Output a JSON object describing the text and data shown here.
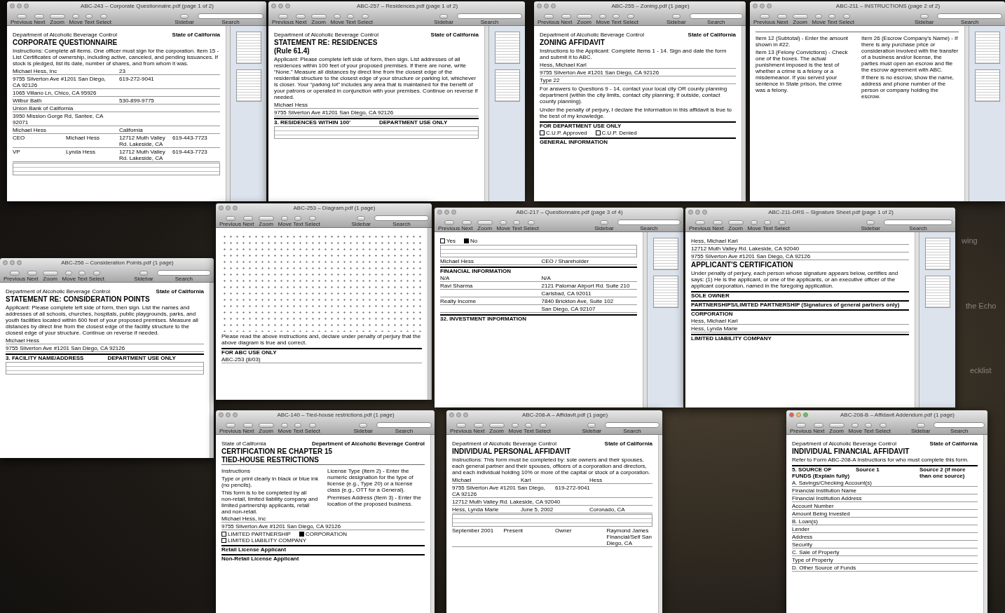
{
  "desktop_labels": [
    "wing",
    "the Echo",
    "ecklist"
  ],
  "windows": [
    {
      "title": "ABC-243 – Corporate Questionnaire.pdf (page 1 of 2)",
      "active": false,
      "sidebar": true,
      "toolbar": {
        "nav": [
          "Previous",
          "Next"
        ],
        "zoom": "Zoom",
        "tools": [
          "Move",
          "Text",
          "Select"
        ],
        "sidebar": "Sidebar",
        "search": "Search"
      },
      "page": [
        {
          "kind": "agency",
          "left": "Department of Alcoholic Beverage Control",
          "right": "State of California"
        },
        {
          "kind": "heading",
          "text": "CORPORATE QUESTIONNAIRE"
        },
        {
          "kind": "para",
          "text": "Instructions: Complete all items. One officer must sign for the corporation. Item 15 - List Certificates of ownership, including active, canceled, and pending issuances. If stock is pledged, list its date, number of shares, and from whom it was."
        },
        {
          "kind": "row",
          "cells": [
            "Michael Hess, Inc",
            "23"
          ]
        },
        {
          "kind": "row",
          "cells": [
            "9755 Silverton Ave #1201 San Diego, CA 92126",
            "619-272-9041"
          ]
        },
        {
          "kind": "row",
          "cells": [
            "1065 Villano Ln, Chico, CA 95926",
            ""
          ]
        },
        {
          "kind": "row",
          "cells": [
            "Wilbur Bath",
            "530-899-9775"
          ]
        },
        {
          "kind": "row",
          "cells": [
            "Union Bank of California",
            ""
          ]
        },
        {
          "kind": "row",
          "cells": [
            "3950 Mission Gorge Rd, Santee, CA 92071",
            ""
          ]
        },
        {
          "kind": "row",
          "cells": [
            "Michael Hess",
            "California"
          ]
        },
        {
          "kind": "row",
          "cells": [
            "CEO",
            "Michael Hess",
            "12712 Muth Valley Rd. Lakeside, CA",
            "619-443-7723"
          ]
        },
        {
          "kind": "row",
          "cells": [
            "VP",
            "Lynda Hess",
            "12712 Muth Valley Rd. Lakeside, CA",
            "619-443-7723"
          ]
        },
        {
          "kind": "grid"
        }
      ]
    },
    {
      "title": "ABC-257 – Residences.pdf (page 1 of 2)",
      "active": false,
      "sidebar": true,
      "toolbar": {
        "nav": [
          "Previous",
          "Next"
        ],
        "zoom": "Zoom",
        "tools": [
          "Move",
          "Text",
          "Select"
        ],
        "sidebar": "Sidebar",
        "search": "Search"
      },
      "page": [
        {
          "kind": "agency",
          "left": "Department of Alcoholic Beverage Control",
          "right": "State of California"
        },
        {
          "kind": "heading",
          "text": "STATEMENT RE: RESIDENCES"
        },
        {
          "kind": "heading",
          "text": "(Rule 61.4)"
        },
        {
          "kind": "para",
          "text": "Applicant: Please complete left side of form, then sign. List addresses of all residences within 100 feet of your proposed premises. If there are none, write “None.” Measure all distances by direct line from the closest edge of the residential structure to the closest edge of your structure or parking lot, whichever is closer. Your “parking lot” includes any area that is maintained for the benefit of your patrons or operated in conjunction with your premises. Continue on reverse if needed."
        },
        {
          "kind": "row",
          "cells": [
            "Michael Hess"
          ]
        },
        {
          "kind": "row",
          "cells": [
            "9755 Silverton Ave #1201 San Diego, CA 92126"
          ]
        },
        {
          "kind": "section",
          "cells": [
            "3. RESIDENCES WITHIN 100'",
            "DEPARTMENT USE ONLY"
          ]
        },
        {
          "kind": "grid"
        }
      ]
    },
    {
      "title": "ABC-255 – Zoning.pdf (1 page)",
      "active": false,
      "sidebar": false,
      "toolbar": {
        "nav": [
          "Previous",
          "Next"
        ],
        "zoom": "Zoom",
        "tools": [
          "Move",
          "Text",
          "Select"
        ],
        "sidebar": "Sidebar",
        "search": "Search"
      },
      "page": [
        {
          "kind": "agency",
          "left": "Department of Alcoholic Beverage Control",
          "right": "State of California"
        },
        {
          "kind": "heading",
          "text": "ZONING AFFIDAVIT"
        },
        {
          "kind": "para",
          "text": "Instructions to the Applicant: Complete Items 1 - 14. Sign and date the form and submit it to ABC."
        },
        {
          "kind": "row",
          "cells": [
            "Hess, Michael Karl"
          ]
        },
        {
          "kind": "row",
          "cells": [
            "9755 Silverton Ave #1201 San Diego, CA 92126"
          ]
        },
        {
          "kind": "row",
          "cells": [
            "Type 22"
          ]
        },
        {
          "kind": "para",
          "text": "For answers to Questions 9 - 14, contact your local city OR county planning department (within the city limits, contact city planning; if outside, contact county planning)."
        },
        {
          "kind": "para",
          "text": "Under the penalty of perjury, I declare the information in this affidavit is true to the best of my knowledge."
        },
        {
          "kind": "section",
          "cells": [
            "FOR DEPARTMENT USE ONLY"
          ]
        },
        {
          "kind": "checks",
          "items": [
            {
              "text": "C.U.P. Approved",
              "checked": false
            },
            {
              "text": "C.U.P. Denied",
              "checked": false
            }
          ]
        },
        {
          "kind": "section",
          "cells": [
            "GENERAL INFORMATION"
          ]
        }
      ]
    },
    {
      "title": "ABC-211 – INSTRUCTIONS (page 2 of 2)",
      "active": false,
      "sidebar": true,
      "toolbar": {
        "nav": [
          "Previous",
          "Next"
        ],
        "zoom": "Zoom",
        "tools": [
          "Move",
          "Text",
          "Select"
        ],
        "sidebar": "Sidebar",
        "search": "Search"
      },
      "page": [
        {
          "kind": "columns",
          "left": [
            "Item 12 (Subtotal) - Enter the amount shown in #22.",
            "Item 13 (Felony Convictions) - Check one of the boxes. The actual punishment imposed is the test of whether a crime is a felony or a misdemeanor. If you served your sentence in State prison, the crime was a felony."
          ],
          "right": [
            "Item 26 (Escrow Company's Name) - If there is any purchase price or consideration involved with the transfer of a business and/or license, the parties must open an escrow and file the escrow agreement with ABC.",
            "If there is no escrow, show the name, address and phone number of the person or company holding the escrow."
          ]
        }
      ]
    },
    {
      "title": "ABC-256 – Consideration Points.pdf (1 page)",
      "active": false,
      "sidebar": false,
      "toolbar": {
        "nav": [
          "Previous",
          "Next"
        ],
        "zoom": "Zoom",
        "tools": [
          "Move",
          "Text",
          "Select"
        ],
        "sidebar": "Sidebar",
        "search": "Search"
      },
      "page": [
        {
          "kind": "agency",
          "left": "Department of Alcoholic Beverage Control",
          "right": "State of California"
        },
        {
          "kind": "heading",
          "text": "STATEMENT RE: CONSIDERATION POINTS"
        },
        {
          "kind": "para",
          "text": "Applicant: Please complete left side of form, then sign. List the names and addresses of all schools, churches, hospitals, public playgrounds, parks, and youth facilities located within 600 feet of your proposed premises. Measure all distances by direct line from the closest edge of the facility structure to the closest edge of your structure. Continue on reverse if needed."
        },
        {
          "kind": "row",
          "cells": [
            "Michael Hess"
          ]
        },
        {
          "kind": "row",
          "cells": [
            "9755 Silverton Ave #1201 San Diego, CA 92126"
          ]
        },
        {
          "kind": "section",
          "cells": [
            "3. FACILITY NAME/ADDRESS",
            "DEPARTMENT USE ONLY"
          ]
        },
        {
          "kind": "grid"
        }
      ]
    },
    {
      "title": "ABC-253 – Diagram.pdf (1 page)",
      "active": false,
      "sidebar": false,
      "toolbar": {
        "nav": [
          "Previous",
          "Next"
        ],
        "zoom": "Zoom",
        "tools": [
          "Move",
          "Text",
          "Select"
        ],
        "sidebar": "Sidebar",
        "search": "Search"
      },
      "page": [
        {
          "kind": "dots"
        },
        {
          "kind": "para",
          "text": "Please read the above instructions and, declare under penalty of perjury that the above diagram is true and correct."
        },
        {
          "kind": "section",
          "cells": [
            "FOR ABC USE ONLY"
          ]
        },
        {
          "kind": "row",
          "cells": [
            "ABC-253 (8/03)"
          ]
        }
      ]
    },
    {
      "title": "ABC-217 – Questionnaire.pdf (page 3 of 4)",
      "active": false,
      "sidebar": true,
      "toolbar": {
        "nav": [
          "Previous",
          "Next"
        ],
        "zoom": "Zoom",
        "tools": [
          "Move",
          "Text",
          "Select"
        ],
        "sidebar": "Sidebar",
        "search": "Search"
      },
      "page": [
        {
          "kind": "checks",
          "items": [
            {
              "text": "Yes",
              "checked": false
            },
            {
              "text": "No",
              "checked": true
            }
          ]
        },
        {
          "kind": "grid"
        },
        {
          "kind": "row",
          "cells": [
            "Michael Hess",
            "CEO / Shareholder"
          ]
        },
        {
          "kind": "section",
          "cells": [
            "FINANCIAL INFORMATION"
          ]
        },
        {
          "kind": "row",
          "cells": [
            "N/A",
            "N/A"
          ]
        },
        {
          "kind": "row",
          "cells": [
            "Ravi Sharma",
            "2121 Palomar Airport Rd. Suite 210"
          ]
        },
        {
          "kind": "row",
          "cells": [
            "",
            "Carlsbad, CA 92011"
          ]
        },
        {
          "kind": "row",
          "cells": [
            "Realty Income",
            "7840 Brickton Ave, Suite 102"
          ]
        },
        {
          "kind": "row",
          "cells": [
            "",
            "San Diego, CA 92107"
          ]
        },
        {
          "kind": "section",
          "cells": [
            "32. INVESTMENT INFORMATION"
          ]
        }
      ]
    },
    {
      "title": "ABC-211-DRS – Signature Sheet.pdf (page 1 of 2)",
      "active": false,
      "sidebar": true,
      "toolbar": {
        "nav": [
          "Previous",
          "Next"
        ],
        "zoom": "Zoom",
        "tools": [
          "Move",
          "Text",
          "Select"
        ],
        "sidebar": "Sidebar",
        "search": "Search"
      },
      "page": [
        {
          "kind": "row",
          "cells": [
            "Hess, Michael Karl"
          ]
        },
        {
          "kind": "row",
          "cells": [
            "12712 Muth Valley Rd. Lakeside, CA 92040"
          ]
        },
        {
          "kind": "row",
          "cells": [
            "9755 Silverton Ave #1201 San Diego, CA 92126"
          ]
        },
        {
          "kind": "heading",
          "text": "APPLICANT'S CERTIFICATION"
        },
        {
          "kind": "para",
          "text": "Under penalty of perjury, each person whose signature appears below, certifies and says: (1) He is the applicant, or one of the applicants, or an executive officer of the applicant corporation, named in the foregoing application."
        },
        {
          "kind": "section",
          "cells": [
            "SOLE OWNER"
          ]
        },
        {
          "kind": "section",
          "cells": [
            "PARTNERSHIPS/LIMITED PARTNERSHIP (Signatures of general partners only)"
          ]
        },
        {
          "kind": "section",
          "cells": [
            "CORPORATION"
          ]
        },
        {
          "kind": "row",
          "cells": [
            "Hess, Michael Karl"
          ]
        },
        {
          "kind": "row",
          "cells": [
            "Hess, Lynda Marie"
          ]
        },
        {
          "kind": "section",
          "cells": [
            "LIMITED LIABILITY COMPANY"
          ]
        }
      ]
    },
    {
      "title": "ABC-140 – Tied-house restrictions.pdf (1 page)",
      "active": false,
      "sidebar": false,
      "toolbar": {
        "nav": [
          "Previous",
          "Next"
        ],
        "zoom": "Zoom",
        "tools": [
          "Move",
          "Text",
          "Select"
        ],
        "sidebar": "Sidebar",
        "search": "Search"
      },
      "page": [
        {
          "kind": "agency",
          "left": "State of California",
          "right": "Department of Alcoholic Beverage Control"
        },
        {
          "kind": "heading",
          "text": "CERTIFICATION RE CHAPTER 15"
        },
        {
          "kind": "heading",
          "text": "TIED-HOUSE RESTRICTIONS"
        },
        {
          "kind": "columns",
          "left": [
            "Instructions",
            "Type or print clearly in black or blue ink (no pencils).",
            "This form is to be completed by all non-retail, limited liability company and limited partnership applicants, retail and non-retail."
          ],
          "right": [
            "License Type (Item 2) - Enter the numeric designation for the type of license (e.g., Type 20) or a license class (e.g., OTT for a General).",
            "Premises Address (Item 3) - Enter the location of the proposed business."
          ]
        },
        {
          "kind": "row",
          "cells": [
            "Michael Hess, Inc"
          ]
        },
        {
          "kind": "row",
          "cells": [
            "9755 Silverton Ave #1201 San Diego, CA 92126"
          ]
        },
        {
          "kind": "checks",
          "items": [
            {
              "text": "LIMITED PARTNERSHIP",
              "checked": false
            },
            {
              "text": "CORPORATION",
              "checked": true
            },
            {
              "text": "LIMITED LIABILITY COMPANY",
              "checked": false
            }
          ]
        },
        {
          "kind": "section",
          "cells": [
            "Retail License Applicant"
          ]
        },
        {
          "kind": "section",
          "cells": [
            "Non-Retail License Applicant"
          ]
        }
      ]
    },
    {
      "title": "ABC-208-A – Affidavit.pdf (1 page)",
      "active": false,
      "sidebar": false,
      "toolbar": {
        "nav": [
          "Previous",
          "Next"
        ],
        "zoom": "Zoom",
        "tools": [
          "Move",
          "Text",
          "Select"
        ],
        "sidebar": "Sidebar",
        "search": "Search"
      },
      "page": [
        {
          "kind": "agency",
          "left": "Department of Alcoholic Beverage Control",
          "right": "State of California"
        },
        {
          "kind": "heading",
          "text": "INDIVIDUAL PERSONAL AFFIDAVIT"
        },
        {
          "kind": "para",
          "text": "Instructions: This form must be completed by: sole owners and their spouses, each general partner and their spouses, officers of a corporation and directors, and each individual holding 10% or more of the capital or stock of a corporation."
        },
        {
          "kind": "row",
          "cells": [
            "Michael",
            "Karl",
            "Hess"
          ]
        },
        {
          "kind": "row",
          "cells": [
            "9755 Silverton Ave #1201 San Diego, CA 92126",
            "619-272-9041"
          ]
        },
        {
          "kind": "row",
          "cells": [
            "12712 Muth Valley Rd. Lakeside, CA 92040"
          ]
        },
        {
          "kind": "row",
          "cells": [
            "Hess, Lynda Marie",
            "June 5, 2002",
            "Coronado, CA"
          ]
        },
        {
          "kind": "grid"
        },
        {
          "kind": "row",
          "cells": [
            "September 2001",
            "Present",
            "Owner",
            "Raymond James Financial/Self San Diego, CA"
          ]
        }
      ]
    },
    {
      "title": "ABC-208-B – Affidavit Addendum.pdf (1 page)",
      "active": true,
      "sidebar": false,
      "toolbar": {
        "nav": [
          "Previous",
          "Next"
        ],
        "zoom": "Zoom",
        "tools": [
          "Move",
          "Text",
          "Select"
        ],
        "sidebar": "Sidebar",
        "search": "Search"
      },
      "page": [
        {
          "kind": "agency",
          "left": "Department of Alcoholic Beverage Control",
          "right": "State of California"
        },
        {
          "kind": "heading",
          "text": "INDIVIDUAL FINANCIAL AFFIDAVIT"
        },
        {
          "kind": "para",
          "text": "Refer to Form ABC-208-A Instructions for who must complete this form."
        },
        {
          "kind": "section",
          "cells": [
            "5. SOURCE OF FUNDS (Explain fully)",
            "Source 1",
            "Source 2 (if more than one source)"
          ]
        },
        {
          "kind": "row",
          "cells": [
            "A. Savings/Checking Account(s)"
          ]
        },
        {
          "kind": "row",
          "cells": [
            "Financial Institution Name"
          ]
        },
        {
          "kind": "row",
          "cells": [
            "Financial Institution Address"
          ]
        },
        {
          "kind": "row",
          "cells": [
            "Account Number"
          ]
        },
        {
          "kind": "row",
          "cells": [
            "Amount Being Invested"
          ]
        },
        {
          "kind": "row",
          "cells": [
            "B. Loan(s)"
          ]
        },
        {
          "kind": "row",
          "cells": [
            "Lender"
          ]
        },
        {
          "kind": "row",
          "cells": [
            "Address"
          ]
        },
        {
          "kind": "row",
          "cells": [
            "Security"
          ]
        },
        {
          "kind": "row",
          "cells": [
            "C. Sale of Property"
          ]
        },
        {
          "kind": "row",
          "cells": [
            "Type of Property"
          ]
        },
        {
          "kind": "row",
          "cells": [
            "D. Other Source of Funds"
          ]
        }
      ]
    }
  ]
}
